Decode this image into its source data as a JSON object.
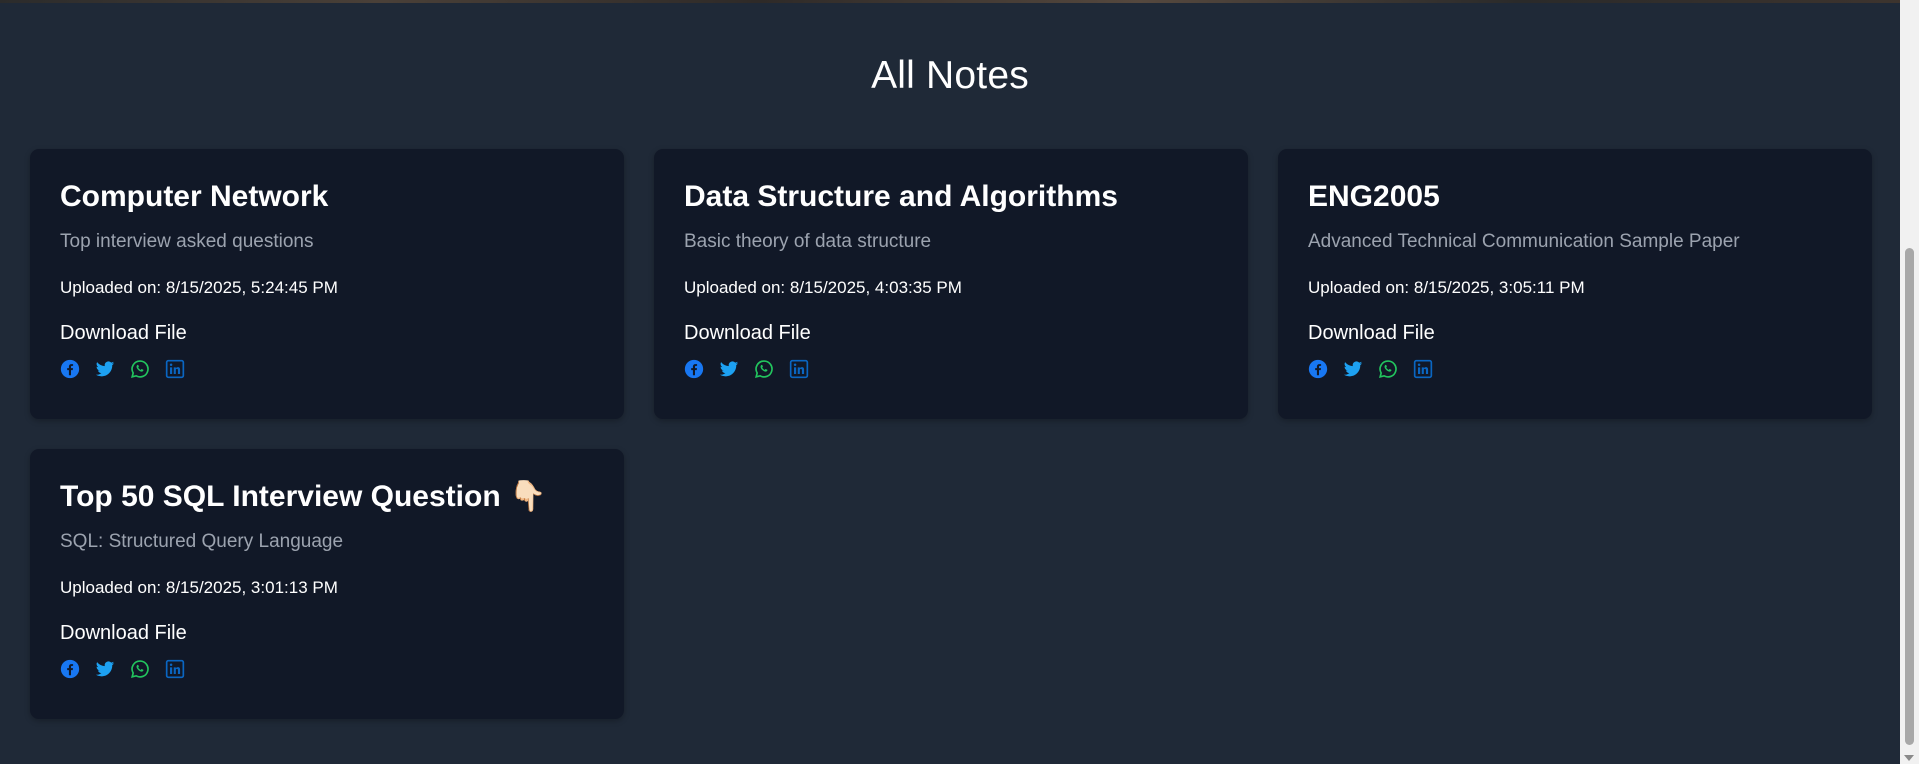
{
  "page": {
    "title": "All Notes"
  },
  "notes": [
    {
      "title": "Computer Network",
      "description": "Top interview asked questions",
      "uploaded": "Uploaded on: 8/15/2025, 5:24:45 PM",
      "download_label": "Download File"
    },
    {
      "title": "Data Structure and Algorithms",
      "description": "Basic theory of data structure",
      "uploaded": "Uploaded on: 8/15/2025, 4:03:35 PM",
      "download_label": "Download File"
    },
    {
      "title": "ENG2005",
      "description": "Advanced Technical Communication Sample Paper",
      "uploaded": "Uploaded on: 8/15/2025, 3:05:11 PM",
      "download_label": "Download File"
    },
    {
      "title": "Top 50 SQL Interview Question 👇🏻",
      "description": "SQL: Structured Query Language",
      "uploaded": "Uploaded on: 8/15/2025, 3:01:13 PM",
      "download_label": "Download File"
    }
  ],
  "share_icons": [
    {
      "name": "facebook-icon",
      "color": "#1877f2"
    },
    {
      "name": "twitter-icon",
      "color": "#1da1f2"
    },
    {
      "name": "whatsapp-icon",
      "color": "#22c55e"
    },
    {
      "name": "linkedin-icon",
      "color": "#0a66c2"
    }
  ],
  "colors": {
    "page_background": "#1f2937",
    "card_background": "#111827",
    "description_text": "#9ca3af"
  }
}
